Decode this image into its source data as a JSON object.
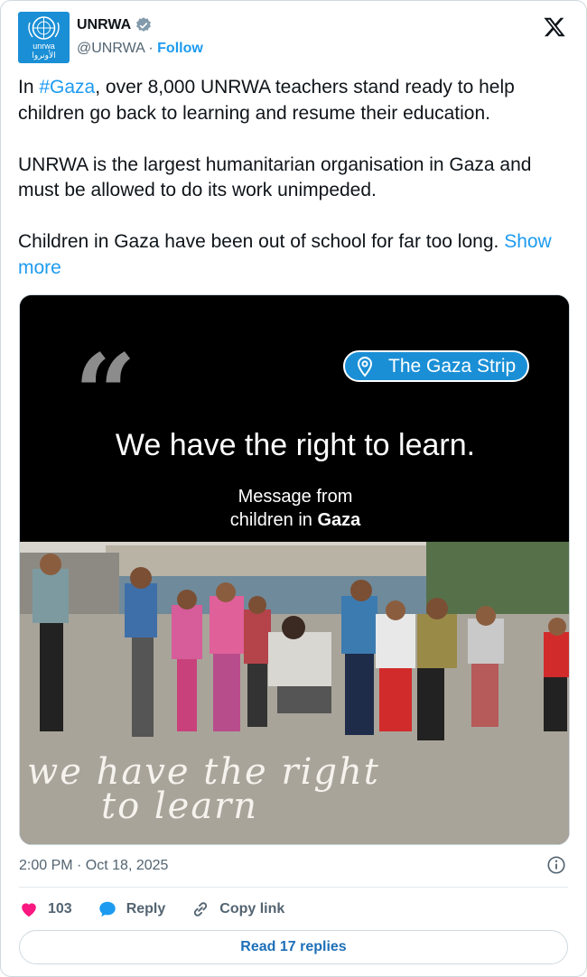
{
  "account": {
    "display_name": "UNRWA",
    "handle": "@UNRWA",
    "separator": "·",
    "follow_label": "Follow",
    "avatar_text": "unrwa",
    "avatar_text_ar": "الأونروا",
    "brand_color": "#1a8fd6"
  },
  "tweet": {
    "p1_prefix": "In ",
    "p1_hashtag": "#Gaza",
    "p1_suffix": ", over 8,000 UNRWA teachers stand ready to help children go back to learning and resume their education.",
    "p2": "UNRWA is the largest humanitarian organisation in Gaza and must be allowed to do its work unimpeded.",
    "p3": "Children in Gaza have been out of school for far too long.",
    "show_more": "Show more"
  },
  "media": {
    "location_pill": "The Gaza Strip",
    "headline": "We have the right to learn.",
    "sub_line1": "Message from",
    "sub_line2_prefix": "children in ",
    "sub_line2_bold": "Gaza",
    "chalk_line1": "we have the right",
    "chalk_line2": "to learn"
  },
  "meta": {
    "timestamp": "2:00 PM · Oct 18, 2025"
  },
  "actions": {
    "like_count": "103",
    "reply_label": "Reply",
    "copy_link_label": "Copy link",
    "read_replies_label": "Read 17 replies"
  },
  "colors": {
    "accent": "#1d9bf0",
    "like": "#f91880",
    "text_secondary": "#536471"
  },
  "icons": {
    "verified": "verified-badge-icon",
    "x_logo": "x-logo-icon",
    "location": "location-pin-icon",
    "info": "info-icon",
    "like": "heart-icon",
    "reply": "speech-bubble-icon",
    "copy_link": "link-icon"
  }
}
